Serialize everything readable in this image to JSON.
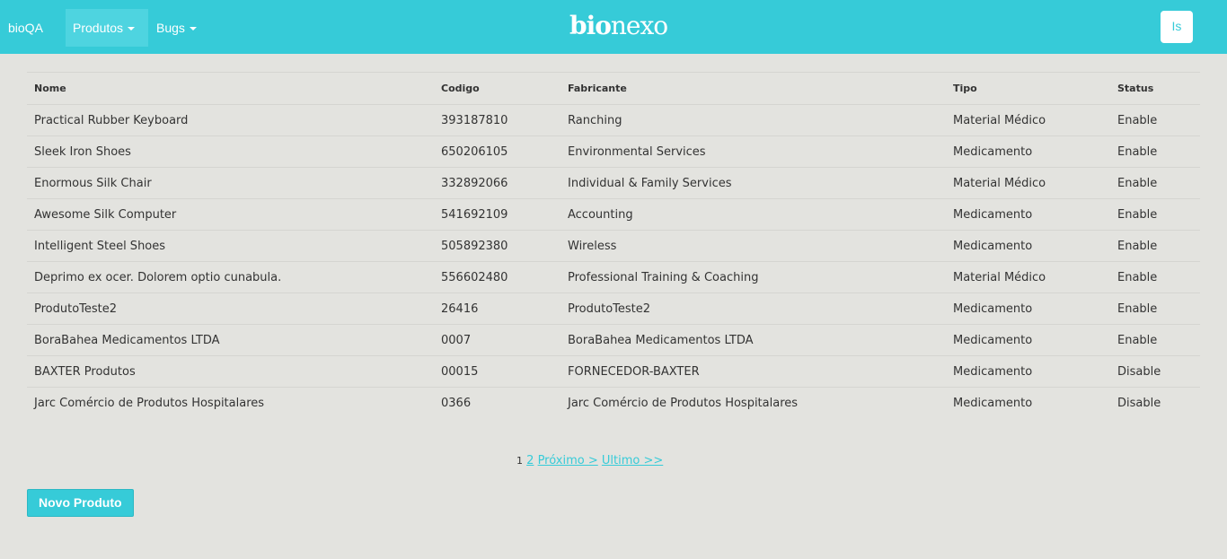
{
  "navbar": {
    "brand": "bioQA",
    "menu": [
      {
        "label": "Produtos",
        "active": true
      },
      {
        "label": "Bugs",
        "active": false
      }
    ],
    "logo_bold": "bio",
    "logo_light": "nexo",
    "user_button": "Is"
  },
  "table": {
    "headers": [
      "Nome",
      "Codigo",
      "Fabricante",
      "Tipo",
      "Status"
    ],
    "rows": [
      [
        "Practical Rubber Keyboard",
        "393187810",
        "Ranching",
        "Material Médico",
        "Enable"
      ],
      [
        "Sleek Iron Shoes",
        "650206105",
        "Environmental Services",
        "Medicamento",
        "Enable"
      ],
      [
        "Enormous Silk Chair",
        "332892066",
        "Individual & Family Services",
        "Material Médico",
        "Enable"
      ],
      [
        "Awesome Silk Computer",
        "541692109",
        "Accounting",
        "Medicamento",
        "Enable"
      ],
      [
        "Intelligent Steel Shoes",
        "505892380",
        "Wireless",
        "Medicamento",
        "Enable"
      ],
      [
        "Deprimo ex ocer. Dolorem optio cunabula.",
        "556602480",
        "Professional Training & Coaching",
        "Material Médico",
        "Enable"
      ],
      [
        "ProdutoTeste2",
        "26416",
        "ProdutoTeste2",
        "Medicamento",
        "Enable"
      ],
      [
        "BoraBahea Medicamentos LTDA",
        "0007",
        "BoraBahea Medicamentos LTDA",
        "Medicamento",
        "Enable"
      ],
      [
        "BAXTER Produtos",
        "00015",
        "FORNECEDOR-BAXTER",
        "Medicamento",
        "Disable"
      ],
      [
        "Jarc Comércio de Produtos Hospitalares",
        "0366",
        "Jarc Comércio de Produtos Hospitalares",
        "Medicamento",
        "Disable"
      ]
    ]
  },
  "pagination": {
    "current": "1",
    "page2": "2",
    "next": "Próximo >",
    "last": "Ultimo >>"
  },
  "actions": {
    "new_product": "Novo Produto"
  },
  "colors": {
    "accent": "#36cbd8",
    "background": "#e3e3df"
  }
}
